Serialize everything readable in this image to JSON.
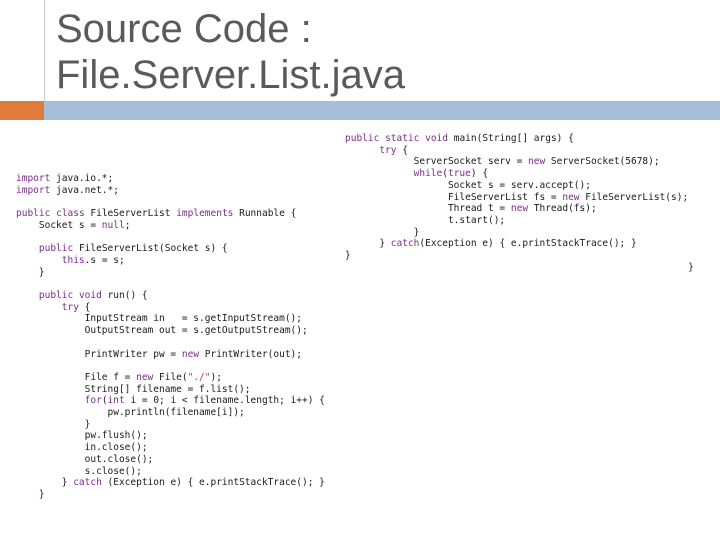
{
  "slide": {
    "title": "Source Code :\nFile.Server.List.java"
  },
  "code_left": {
    "lines": [
      "import java.io.*;",
      "import java.net.*;",
      "",
      "public class FileServerList implements Runnable {",
      "    Socket s = null;",
      "",
      "    public FileServerList(Socket s) {",
      "        this.s = s;",
      "    }",
      "",
      "    public void run() {",
      "        try {",
      "            InputStream in   = s.getInputStream();",
      "            OutputStream out = s.getOutputStream();",
      "",
      "            PrintWriter pw = new PrintWriter(out);",
      "",
      "            File f = new File(\"./\");",
      "            String[] filename = f.list();",
      "            for(int i = 0; i < filename.length; i++) {",
      "                pw.println(filename[i]);",
      "            }",
      "            pw.flush();",
      "            in.close();",
      "            out.close();",
      "            s.close();",
      "        } catch (Exception e) { e.printStackTrace(); }",
      "    }"
    ]
  },
  "code_right": {
    "lines": [
      "public static void main(String[] args) {",
      "      try {",
      "            ServerSocket serv = new ServerSocket(5678);",
      "            while(true) {",
      "                  Socket s = serv.accept();",
      "                  FileServerList fs = new FileServerList(s);",
      "                  Thread t = new Thread(fs);",
      "                  t.start();",
      "            }",
      "      } catch(Exception e) { e.printStackTrace(); }",
      "}",
      "                                                            }"
    ]
  }
}
